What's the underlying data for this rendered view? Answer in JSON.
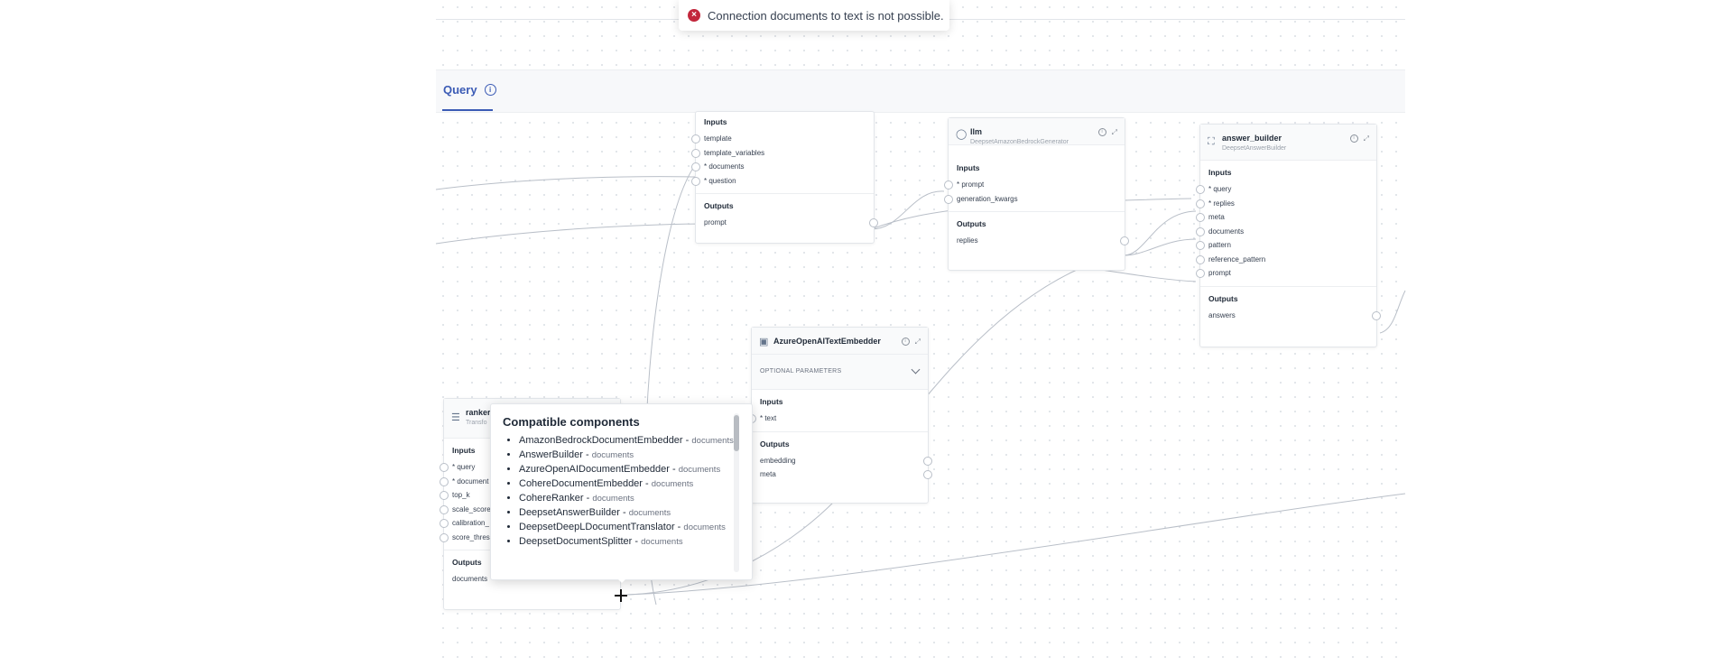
{
  "toast": {
    "message": "Connection documents to text is not possible.",
    "icon": "error-icon"
  },
  "tabs": [
    {
      "label": "Query",
      "active": true
    }
  ],
  "nodes": {
    "prompt_builder": {
      "inputs_title": "Inputs",
      "inputs": [
        "template",
        "template_variables",
        "* documents",
        "* question"
      ],
      "outputs_title": "Outputs",
      "outputs": [
        "prompt"
      ]
    },
    "llm": {
      "name": "llm",
      "type": "DeepsetAmazonBedrockGenerator",
      "inputs_title": "Inputs",
      "inputs": [
        "* prompt",
        "generation_kwargs"
      ],
      "outputs_title": "Outputs",
      "outputs": [
        "replies"
      ]
    },
    "answer_builder": {
      "name": "answer_builder",
      "type": "DeepsetAnswerBuilder",
      "inputs_title": "Inputs",
      "inputs": [
        "* query",
        "* replies",
        "meta",
        "documents",
        "pattern",
        "reference_pattern",
        "prompt"
      ],
      "outputs_title": "Outputs",
      "outputs": [
        "answers"
      ]
    },
    "embedder": {
      "name": "AzureOpenAITextEmbedder",
      "optional_label": "OPTIONAL PARAMETERS",
      "inputs_title": "Inputs",
      "inputs": [
        "* text"
      ],
      "outputs_title": "Outputs",
      "outputs": [
        "embedding",
        "meta"
      ]
    },
    "ranker": {
      "name": "ranker",
      "type": "Transfo",
      "inputs_title": "Inputs",
      "inputs": [
        "* query",
        "* document",
        "top_k",
        "scale_score",
        "calibration_",
        "score_thres"
      ],
      "outputs_title": "Outputs",
      "outputs": [
        "documents"
      ]
    }
  },
  "popover": {
    "title": "Compatible components",
    "items": [
      {
        "name": "AmazonBedrockDocumentEmbedder -",
        "type": "documents"
      },
      {
        "name": "AnswerBuilder -",
        "type": "documents"
      },
      {
        "name": "AzureOpenAIDocumentEmbedder -",
        "type": "documents"
      },
      {
        "name": "CohereDocumentEmbedder -",
        "type": "documents"
      },
      {
        "name": "CohereRanker -",
        "type": "documents"
      },
      {
        "name": "DeepsetAnswerBuilder -",
        "type": "documents"
      },
      {
        "name": "DeepsetDeepLDocumentTranslator -",
        "type": "documents"
      },
      {
        "name": "DeepsetDocumentSplitter -",
        "type": "documents"
      }
    ]
  },
  "colors": {
    "accent": "#3b5bb5",
    "error": "#c2263b",
    "edge": "#b9bfc8"
  }
}
